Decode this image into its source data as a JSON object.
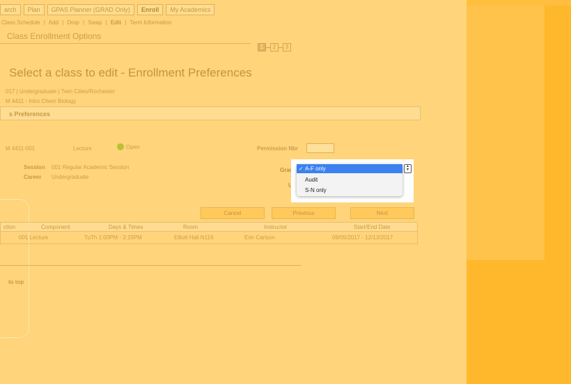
{
  "topnav": [
    "arch",
    "Plan",
    "GPAS Planner (GRAD Only)",
    "Enroll",
    "My Academics"
  ],
  "subnav": {
    "items": [
      "Class Schedule",
      "Add",
      "Drop",
      "Swap",
      "Edit",
      "Term Information"
    ],
    "separator": "|"
  },
  "section_title": "Class Enrollment Options",
  "steps": [
    "1",
    "2",
    "3"
  ],
  "heading": "Select a class to edit - Enrollment Preferences",
  "term": "017 | Undergraduate | Twin Cities/Rochester",
  "course": "M 4411 - Intro Chem Biology",
  "prefs_bar": "s Preferences",
  "class": {
    "section": "M 4411-001",
    "component": "Lecture",
    "status": "Open"
  },
  "permission_label": "Permission Nbr",
  "session": {
    "label": "Session",
    "value": "001 Regular Academic Session"
  },
  "career": {
    "label": "Career",
    "value": "Undergraduate"
  },
  "grading_label": "Gradi",
  "units_label": "Un",
  "grading_menu": {
    "check": "✓",
    "options": [
      "A-F only",
      "Audit",
      "S-N only"
    ],
    "selected": "A-F only"
  },
  "buttons": {
    "cancel": "Cancel",
    "previous": "Previous",
    "next": "Next"
  },
  "table": {
    "columns": [
      "ction",
      "Component",
      "Days & Times",
      "Room",
      "Instructor",
      "Start/End Date"
    ],
    "rows": [
      [
        "",
        "001 Lecture",
        "TuTh 1:00PM - 2:15PM",
        "Elliott Hall N119",
        "Erin Carlson",
        "09/05/2017 - 12/13/2017"
      ]
    ]
  },
  "back_to_top": "to top",
  "colors": {
    "overlay": "#ffd47a",
    "right_panel": "#ffb82b",
    "selected_option": "#3b82f0"
  }
}
